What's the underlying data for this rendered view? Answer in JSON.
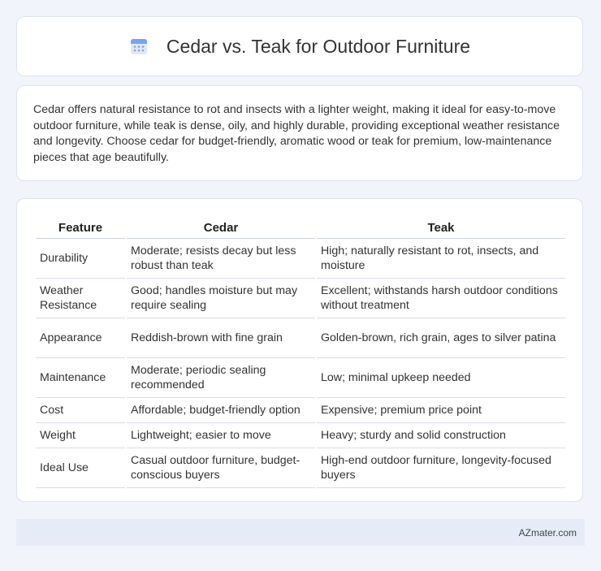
{
  "header": {
    "title": "Cedar vs. Teak for Outdoor Furniture",
    "icon": "calendar-icon"
  },
  "summary": "Cedar offers natural resistance to rot and insects with a lighter weight, making it ideal for easy-to-move outdoor furniture, while teak is dense, oily, and highly durable, providing exceptional weather resistance and longevity. Choose cedar for budget-friendly, aromatic wood or teak for premium, low-maintenance pieces that age beautifully.",
  "table": {
    "headers": [
      "Feature",
      "Cedar",
      "Teak"
    ],
    "rows": [
      [
        "Durability",
        "Moderate; resists decay but less robust than teak",
        "High; naturally resistant to rot, insects, and moisture"
      ],
      [
        "Weather Resistance",
        "Good; handles moisture but may require sealing",
        "Excellent; withstands harsh outdoor conditions without treatment"
      ],
      [
        "Appearance",
        "Reddish-brown with fine grain",
        "Golden-brown, rich grain, ages to silver patina"
      ],
      [
        "Maintenance",
        "Moderate; periodic sealing recommended",
        "Low; minimal upkeep needed"
      ],
      [
        "Cost",
        "Affordable; budget-friendly option",
        "Expensive; premium price point"
      ],
      [
        "Weight",
        "Lightweight; easier to move",
        "Heavy; sturdy and solid construction"
      ],
      [
        "Ideal Use",
        "Casual outdoor furniture, budget-conscious buyers",
        "High-end outdoor furniture, longevity-focused buyers"
      ]
    ]
  },
  "footer": {
    "source": "AZmater.com"
  },
  "colors": {
    "background": "#f1f4fa",
    "footer": "#e6ecf7",
    "icon_blue": "#5b8def"
  }
}
